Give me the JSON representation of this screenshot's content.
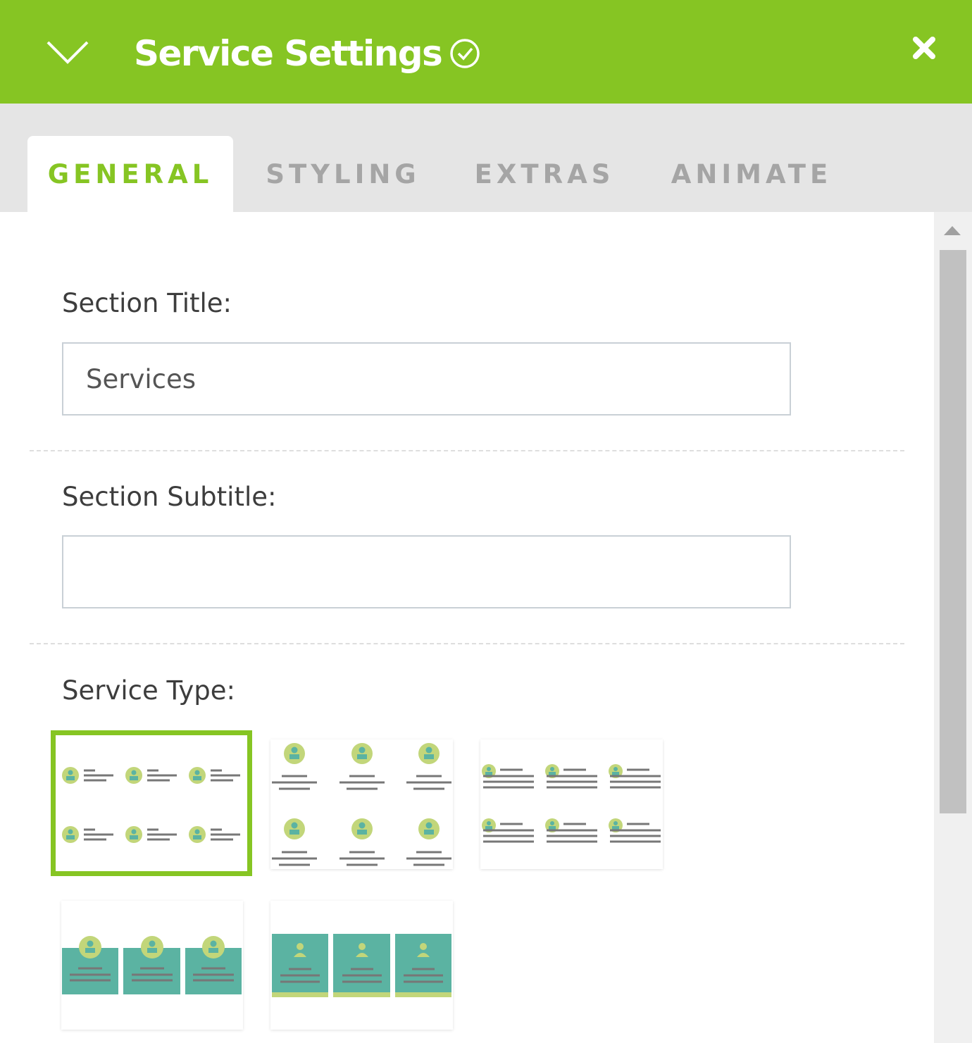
{
  "header": {
    "title": "Service Settings",
    "icons": {
      "collapse": "chevron-down-icon",
      "status": "check-circle-icon",
      "close": "close-icon"
    }
  },
  "tabs": [
    {
      "label": "GENERAL",
      "active": true
    },
    {
      "label": "STYLING",
      "active": false
    },
    {
      "label": "EXTRAS",
      "active": false
    },
    {
      "label": "ANIMATE",
      "active": false
    }
  ],
  "form": {
    "section_title": {
      "label": "Section Title:",
      "value": "Services"
    },
    "section_subtitle": {
      "label": "Section Subtitle:",
      "value": ""
    },
    "service_type": {
      "label": "Service Type:",
      "selected": 1,
      "options": [
        "layout-1",
        "layout-2",
        "layout-3",
        "layout-4",
        "layout-5"
      ]
    }
  },
  "colors": {
    "accent": "#86c523",
    "tab_inactive": "#a5a5a5",
    "thumb_icon": "#c2d67a",
    "thumb_card": "#5bb3a2",
    "thumb_line": "#777777"
  }
}
